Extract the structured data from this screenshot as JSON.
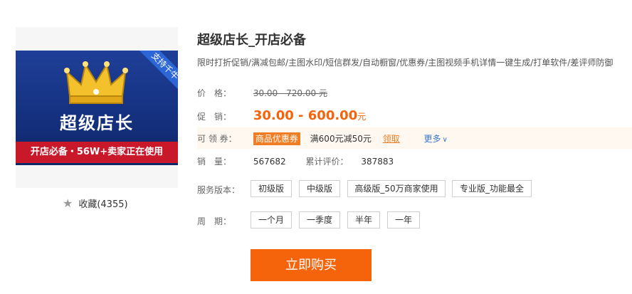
{
  "product_image": {
    "banner_title": "超级店长",
    "ribbon": "支持千牛",
    "strip": "开店必备・56W+卖家正在使用"
  },
  "collect": {
    "label": "收藏(4355)"
  },
  "title": "超级店长_开店必备",
  "subtitle": "限时打折促销/满减包邮/主图水印/短信群发/自动橱窗/优惠券/主图视频手机详情一键生成/打单软件/差评师防御",
  "price": {
    "label": "价　格：",
    "value": "30.00 - 720.00 元"
  },
  "promo": {
    "label": "促　销：",
    "value": "30.00 - 600.00",
    "unit": "元"
  },
  "coupon": {
    "label": "可 领 券：",
    "badge": "商品优惠券",
    "text": "满600元减50元",
    "claim": "领取",
    "more": "更多"
  },
  "sales": {
    "label": "销　量：",
    "value": "567682",
    "review_label": "累计评价：",
    "review_value": "387883"
  },
  "version": {
    "label": "服务版本：",
    "options": [
      "初级版",
      "中级版",
      "高级版_50万商家使用",
      "专业版_功能最全"
    ]
  },
  "period": {
    "label": "周　期：",
    "options": [
      "一个月",
      "一季度",
      "半年",
      "一年"
    ]
  },
  "buy_button": "立即购买",
  "colors": {
    "accent": "#f5640b",
    "link": "#3977d1",
    "banner": "#1f3f98",
    "strip": "#c8182a"
  }
}
